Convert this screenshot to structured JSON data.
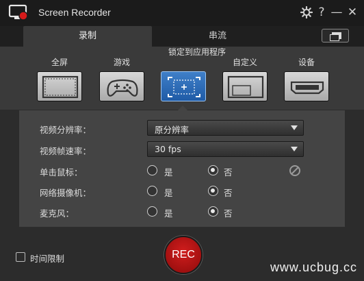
{
  "window": {
    "title": "Screen Recorder",
    "help_glyph": "?",
    "minimize_glyph": "—",
    "close_glyph": "✕"
  },
  "tabs": [
    {
      "label": "录制",
      "active": true
    },
    {
      "label": "串流",
      "active": false
    }
  ],
  "modes": [
    {
      "label": "全屏",
      "icon": "fullscreen-icon",
      "active": false
    },
    {
      "label": "游戏",
      "icon": "gamepad-icon",
      "active": false
    },
    {
      "label": "锁定到应用程序",
      "icon": "lock-app-icon",
      "active": true
    },
    {
      "label": "自定义",
      "icon": "custom-area-icon",
      "active": false
    },
    {
      "label": "设备",
      "icon": "hdmi-device-icon",
      "active": false
    }
  ],
  "settings": {
    "resolution_label": "视频分辨率：",
    "resolution_value": "原分辨率",
    "framerate_label": "视频帧速率：",
    "framerate_value": "30 fps",
    "mouse_click_label": "单击鼠标：",
    "webcam_label": "网络摄像机：",
    "microphone_label": "麦克风：",
    "yes_label": "是",
    "no_label": "否",
    "mouse_click_selected": "否",
    "webcam_selected": "否",
    "microphone_selected": "否"
  },
  "footer": {
    "time_limit_label": "时间限制",
    "time_limit_checked": false,
    "rec_label": "REC",
    "watermark": "www.ucbug.cc"
  },
  "colors": {
    "accent": "#2f6fbf",
    "rec": "#c21515"
  }
}
